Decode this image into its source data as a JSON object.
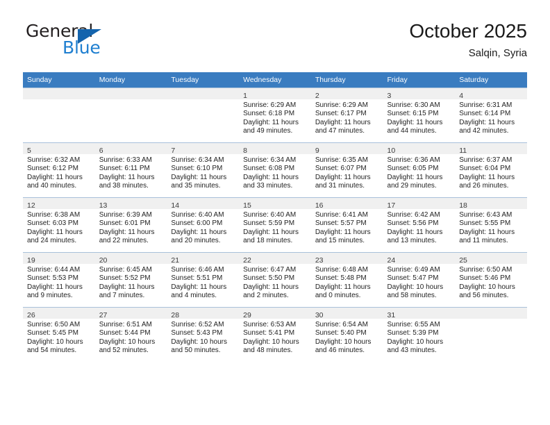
{
  "brand": {
    "name_part1": "General",
    "name_part2": "Blue",
    "flag_icon": "triangle-flag-icon",
    "accent_color": "#1f7fd0"
  },
  "header": {
    "title": "October 2025",
    "subtitle": "Salqin, Syria"
  },
  "colors": {
    "header_row_bg": "#3a7cc0",
    "daynum_bg": "#f0f0f0",
    "grid_line": "#a8c0da",
    "text": "#222222"
  },
  "weekday_headers": [
    "Sunday",
    "Monday",
    "Tuesday",
    "Wednesday",
    "Thursday",
    "Friday",
    "Saturday"
  ],
  "weeks": [
    [
      {
        "day": "",
        "sunrise": "",
        "sunset": "",
        "daylight_line1": "",
        "daylight_line2": "",
        "empty": true
      },
      {
        "day": "",
        "sunrise": "",
        "sunset": "",
        "daylight_line1": "",
        "daylight_line2": "",
        "empty": true
      },
      {
        "day": "",
        "sunrise": "",
        "sunset": "",
        "daylight_line1": "",
        "daylight_line2": "",
        "empty": true
      },
      {
        "day": "1",
        "sunrise": "Sunrise: 6:29 AM",
        "sunset": "Sunset: 6:18 PM",
        "daylight_line1": "Daylight: 11 hours",
        "daylight_line2": "and 49 minutes."
      },
      {
        "day": "2",
        "sunrise": "Sunrise: 6:29 AM",
        "sunset": "Sunset: 6:17 PM",
        "daylight_line1": "Daylight: 11 hours",
        "daylight_line2": "and 47 minutes."
      },
      {
        "day": "3",
        "sunrise": "Sunrise: 6:30 AM",
        "sunset": "Sunset: 6:15 PM",
        "daylight_line1": "Daylight: 11 hours",
        "daylight_line2": "and 44 minutes."
      },
      {
        "day": "4",
        "sunrise": "Sunrise: 6:31 AM",
        "sunset": "Sunset: 6:14 PM",
        "daylight_line1": "Daylight: 11 hours",
        "daylight_line2": "and 42 minutes."
      }
    ],
    [
      {
        "day": "5",
        "sunrise": "Sunrise: 6:32 AM",
        "sunset": "Sunset: 6:12 PM",
        "daylight_line1": "Daylight: 11 hours",
        "daylight_line2": "and 40 minutes."
      },
      {
        "day": "6",
        "sunrise": "Sunrise: 6:33 AM",
        "sunset": "Sunset: 6:11 PM",
        "daylight_line1": "Daylight: 11 hours",
        "daylight_line2": "and 38 minutes."
      },
      {
        "day": "7",
        "sunrise": "Sunrise: 6:34 AM",
        "sunset": "Sunset: 6:10 PM",
        "daylight_line1": "Daylight: 11 hours",
        "daylight_line2": "and 35 minutes."
      },
      {
        "day": "8",
        "sunrise": "Sunrise: 6:34 AM",
        "sunset": "Sunset: 6:08 PM",
        "daylight_line1": "Daylight: 11 hours",
        "daylight_line2": "and 33 minutes."
      },
      {
        "day": "9",
        "sunrise": "Sunrise: 6:35 AM",
        "sunset": "Sunset: 6:07 PM",
        "daylight_line1": "Daylight: 11 hours",
        "daylight_line2": "and 31 minutes."
      },
      {
        "day": "10",
        "sunrise": "Sunrise: 6:36 AM",
        "sunset": "Sunset: 6:05 PM",
        "daylight_line1": "Daylight: 11 hours",
        "daylight_line2": "and 29 minutes."
      },
      {
        "day": "11",
        "sunrise": "Sunrise: 6:37 AM",
        "sunset": "Sunset: 6:04 PM",
        "daylight_line1": "Daylight: 11 hours",
        "daylight_line2": "and 26 minutes."
      }
    ],
    [
      {
        "day": "12",
        "sunrise": "Sunrise: 6:38 AM",
        "sunset": "Sunset: 6:03 PM",
        "daylight_line1": "Daylight: 11 hours",
        "daylight_line2": "and 24 minutes."
      },
      {
        "day": "13",
        "sunrise": "Sunrise: 6:39 AM",
        "sunset": "Sunset: 6:01 PM",
        "daylight_line1": "Daylight: 11 hours",
        "daylight_line2": "and 22 minutes."
      },
      {
        "day": "14",
        "sunrise": "Sunrise: 6:40 AM",
        "sunset": "Sunset: 6:00 PM",
        "daylight_line1": "Daylight: 11 hours",
        "daylight_line2": "and 20 minutes."
      },
      {
        "day": "15",
        "sunrise": "Sunrise: 6:40 AM",
        "sunset": "Sunset: 5:59 PM",
        "daylight_line1": "Daylight: 11 hours",
        "daylight_line2": "and 18 minutes."
      },
      {
        "day": "16",
        "sunrise": "Sunrise: 6:41 AM",
        "sunset": "Sunset: 5:57 PM",
        "daylight_line1": "Daylight: 11 hours",
        "daylight_line2": "and 15 minutes."
      },
      {
        "day": "17",
        "sunrise": "Sunrise: 6:42 AM",
        "sunset": "Sunset: 5:56 PM",
        "daylight_line1": "Daylight: 11 hours",
        "daylight_line2": "and 13 minutes."
      },
      {
        "day": "18",
        "sunrise": "Sunrise: 6:43 AM",
        "sunset": "Sunset: 5:55 PM",
        "daylight_line1": "Daylight: 11 hours",
        "daylight_line2": "and 11 minutes."
      }
    ],
    [
      {
        "day": "19",
        "sunrise": "Sunrise: 6:44 AM",
        "sunset": "Sunset: 5:53 PM",
        "daylight_line1": "Daylight: 11 hours",
        "daylight_line2": "and 9 minutes."
      },
      {
        "day": "20",
        "sunrise": "Sunrise: 6:45 AM",
        "sunset": "Sunset: 5:52 PM",
        "daylight_line1": "Daylight: 11 hours",
        "daylight_line2": "and 7 minutes."
      },
      {
        "day": "21",
        "sunrise": "Sunrise: 6:46 AM",
        "sunset": "Sunset: 5:51 PM",
        "daylight_line1": "Daylight: 11 hours",
        "daylight_line2": "and 4 minutes."
      },
      {
        "day": "22",
        "sunrise": "Sunrise: 6:47 AM",
        "sunset": "Sunset: 5:50 PM",
        "daylight_line1": "Daylight: 11 hours",
        "daylight_line2": "and 2 minutes."
      },
      {
        "day": "23",
        "sunrise": "Sunrise: 6:48 AM",
        "sunset": "Sunset: 5:48 PM",
        "daylight_line1": "Daylight: 11 hours",
        "daylight_line2": "and 0 minutes."
      },
      {
        "day": "24",
        "sunrise": "Sunrise: 6:49 AM",
        "sunset": "Sunset: 5:47 PM",
        "daylight_line1": "Daylight: 10 hours",
        "daylight_line2": "and 58 minutes."
      },
      {
        "day": "25",
        "sunrise": "Sunrise: 6:50 AM",
        "sunset": "Sunset: 5:46 PM",
        "daylight_line1": "Daylight: 10 hours",
        "daylight_line2": "and 56 minutes."
      }
    ],
    [
      {
        "day": "26",
        "sunrise": "Sunrise: 6:50 AM",
        "sunset": "Sunset: 5:45 PM",
        "daylight_line1": "Daylight: 10 hours",
        "daylight_line2": "and 54 minutes."
      },
      {
        "day": "27",
        "sunrise": "Sunrise: 6:51 AM",
        "sunset": "Sunset: 5:44 PM",
        "daylight_line1": "Daylight: 10 hours",
        "daylight_line2": "and 52 minutes."
      },
      {
        "day": "28",
        "sunrise": "Sunrise: 6:52 AM",
        "sunset": "Sunset: 5:43 PM",
        "daylight_line1": "Daylight: 10 hours",
        "daylight_line2": "and 50 minutes."
      },
      {
        "day": "29",
        "sunrise": "Sunrise: 6:53 AM",
        "sunset": "Sunset: 5:41 PM",
        "daylight_line1": "Daylight: 10 hours",
        "daylight_line2": "and 48 minutes."
      },
      {
        "day": "30",
        "sunrise": "Sunrise: 6:54 AM",
        "sunset": "Sunset: 5:40 PM",
        "daylight_line1": "Daylight: 10 hours",
        "daylight_line2": "and 46 minutes."
      },
      {
        "day": "31",
        "sunrise": "Sunrise: 6:55 AM",
        "sunset": "Sunset: 5:39 PM",
        "daylight_line1": "Daylight: 10 hours",
        "daylight_line2": "and 43 minutes."
      },
      {
        "day": "",
        "sunrise": "",
        "sunset": "",
        "daylight_line1": "",
        "daylight_line2": "",
        "empty": true
      }
    ]
  ]
}
